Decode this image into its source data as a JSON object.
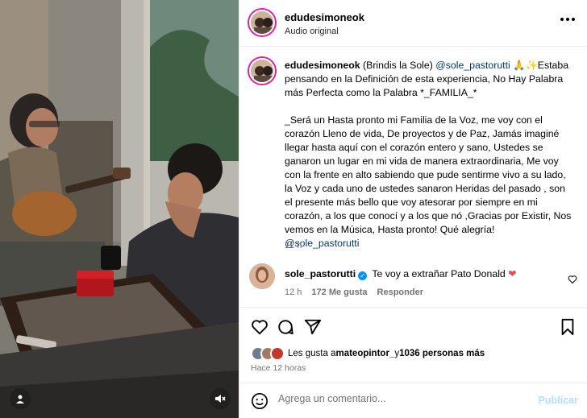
{
  "header": {
    "username": "edudesimoneok",
    "audio": "Audio original"
  },
  "caption": {
    "username": "edudesimoneok",
    "intro": " (Brindis la Sole) ",
    "mention": "@sole_pastorutti",
    "intro_tail": " 🙏✨Estaba pensando en la Definición de esta experiencia, No Hay Palabra más Perfecta como la Palabra *_FAMILIA_*",
    "body": "_Será un Hasta pronto mi Familia de la Voz, me voy con el corazón Lleno de vida, De proyectos y de Paz, Jamás imaginé llegar hasta aquí con el corazón entero y sano, Ustedes se ganaron un lugar en mi vida de manera extraordinaria, Me voy con la frente en alto sabiendo que pude sentirme vivo a su lado, la Voz y cada uno de ustedes sanaron Heridas del pasado , son el presente más bello que voy atesorar por siempre en mi corazón, a los que conocí y a los que nó ,Gracias por Existir, Nos vemos en la Música, Hasta pronto! Qué alegría!",
    "end_mention": "@sole_pastorutti",
    "time": "12 h"
  },
  "comment": {
    "username": "sole_pastorutti",
    "verified": "✓",
    "text": " Te voy a extrañar Pato Donald ",
    "heart": "❤",
    "time": "12 h",
    "likes": "172 Me gusta",
    "reply": "Responder"
  },
  "likes": {
    "prefix": "Les gusta a ",
    "user": "mateopintor_",
    "middle": " y ",
    "count": "1036 personas más"
  },
  "time_ago": "Hace 12 horas",
  "add_comment": {
    "placeholder": "Agrega un comentario...",
    "post": "Publicar"
  },
  "icons": [
    "heart-icon",
    "comment-icon",
    "share-icon",
    "bookmark-icon",
    "more-icon",
    "emoji-icon",
    "user-tag-icon",
    "mute-icon"
  ],
  "colors": {
    "link": "#00376b",
    "secondary": "#737373",
    "post_button": "#b2dffc",
    "verified": "#0095f6",
    "heart": "#ed4956"
  }
}
